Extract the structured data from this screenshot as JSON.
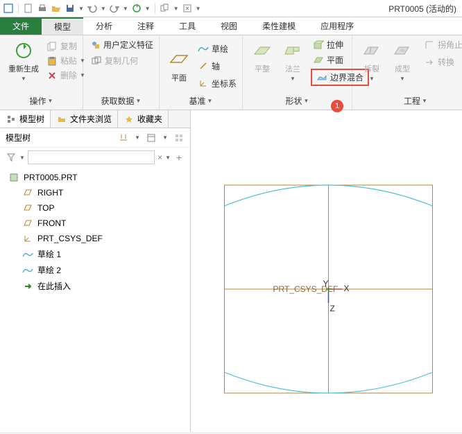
{
  "title": "PRT0005 (活动的)",
  "tabs": {
    "file": "文件",
    "model": "模型",
    "analysis": "分析",
    "annotate": "注释",
    "tools": "工具",
    "view": "视图",
    "flex": "柔性建模",
    "app": "应用程序"
  },
  "ribbon": {
    "g1": {
      "regen": "重新生成",
      "copy": "复制",
      "paste": "粘贴",
      "delete": "删除",
      "footer": "操作"
    },
    "g2": {
      "udf": "用户定义特征",
      "copygeo": "复制几何",
      "footer": "获取数据"
    },
    "g3": {
      "plane": "平面",
      "sketch": "草绘",
      "axis": "轴",
      "csys": "坐标系",
      "footer": "基准"
    },
    "g4": {
      "flat": "平整",
      "falan": "法兰",
      "footer": "形状",
      "extrude": "拉伸",
      "planar": "平面",
      "boundary": "边界混合",
      "marker": "1"
    },
    "g5": {
      "split": "拆裂",
      "form": "成型",
      "corner": "拐角止裂",
      "convert": "转换",
      "footer": "工程"
    }
  },
  "sidebar": {
    "tabs": {
      "tree": "模型树",
      "folder": "文件夹浏览",
      "fav": "收藏夹"
    },
    "header": "模型树",
    "filter_placeholder": "",
    "root": "PRT0005.PRT",
    "items": [
      {
        "icon": "plane",
        "label": "RIGHT"
      },
      {
        "icon": "plane",
        "label": "TOP"
      },
      {
        "icon": "plane",
        "label": "FRONT"
      },
      {
        "icon": "csys",
        "label": "PRT_CSYS_DEF"
      },
      {
        "icon": "sketch",
        "label": "草绘 1"
      },
      {
        "icon": "sketch",
        "label": "草绘 2"
      },
      {
        "icon": "insert",
        "label": "在此插入"
      }
    ]
  },
  "viewport": {
    "csys_label": "PRT_CSYS_DEF",
    "x": "X",
    "y": "Y",
    "z": "Z"
  }
}
